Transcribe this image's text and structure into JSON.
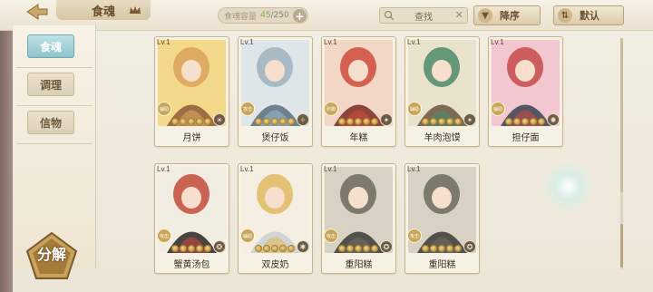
{
  "header": {
    "title": "食魂",
    "capacity_label": "食魂容量",
    "capacity_current": "45",
    "capacity_max": "250",
    "search_label": "查找",
    "sort_label": "降序",
    "default_label": "默认"
  },
  "sidenav": {
    "items": [
      {
        "label": "食魂",
        "active": true
      },
      {
        "label": "调理",
        "active": false
      },
      {
        "label": "信物",
        "active": false
      }
    ],
    "decompose_label": "分解"
  },
  "cards": [
    {
      "lv": "Lv.1",
      "name": "月饼",
      "role": "辅助",
      "palette": [
        "#f4d98a",
        "#d9a25a",
        "#8c5a3a"
      ],
      "elem": "☀"
    },
    {
      "lv": "Lv.1",
      "name": "煲仔饭",
      "role": "攻击",
      "palette": [
        "#dfe6ea",
        "#9fb2bf",
        "#5a6f7e"
      ],
      "elem": "✧"
    },
    {
      "lv": "Lv.1",
      "name": "年糕",
      "role": "防御",
      "palette": [
        "#f2d6c6",
        "#cf4c3a",
        "#7a2a22"
      ],
      "elem": "✦"
    },
    {
      "lv": "Lv.1",
      "name": "羊肉泡馍",
      "role": "辅助",
      "palette": [
        "#e9e2cc",
        "#4d8a6a",
        "#6b5440"
      ],
      "elem": "✶"
    },
    {
      "lv": "Lv.1",
      "name": "担仔面",
      "role": "辅助",
      "palette": [
        "#f3c7cf",
        "#c54a4a",
        "#3a4150"
      ],
      "elem": "✺"
    },
    {
      "lv": "Lv.1",
      "name": "蟹黄汤包",
      "role": "攻击",
      "palette": [
        "#f2ede3",
        "#c44a3a",
        "#2a2622"
      ],
      "elem": "❂"
    },
    {
      "lv": "Lv.1",
      "name": "双皮奶",
      "role": "辅助",
      "palette": [
        "#f4eee3",
        "#e0b860",
        "#c9cfd2"
      ],
      "elem": "✱"
    },
    {
      "lv": "Lv.1",
      "name": "重阳糕",
      "role": "攻击",
      "palette": [
        "#d8d2c4",
        "#6f6a5e",
        "#3b3a36"
      ],
      "elem": "✪"
    },
    {
      "lv": "Lv.1",
      "name": "重阳糕",
      "role": "攻击",
      "palette": [
        "#d8d2c4",
        "#6f6a5e",
        "#3b3a36"
      ],
      "elem": "✪"
    }
  ]
}
